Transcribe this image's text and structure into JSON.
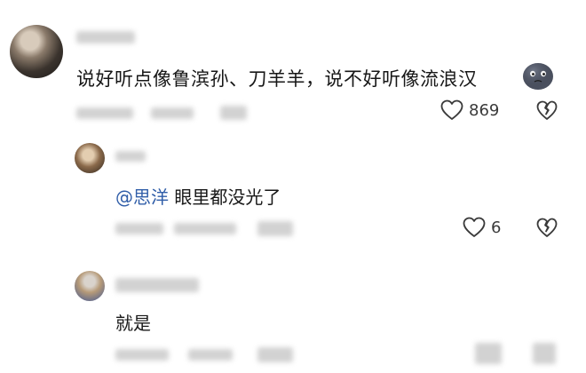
{
  "comments": [
    {
      "text": "说好听点像鲁滨孙、刀羊羊，说不好听像流浪汉",
      "likes": "869",
      "avatar_icon": "avatar-photo",
      "emoji_icon": "dark-moon-face-emoji"
    },
    {
      "mention": "@思洋",
      "text": " 眼里都没光了",
      "likes": "6",
      "avatar_icon": "avatar-photo"
    },
    {
      "text": "就是",
      "avatar_icon": "avatar-photo"
    }
  ],
  "icons": {
    "like": "heart-outline-icon",
    "dislike": "broken-heart-icon"
  },
  "colors": {
    "mention": "#2f5da8",
    "text": "#171717",
    "icon": "#3a3a3a",
    "blurred_meta": "#d2d2d2"
  }
}
